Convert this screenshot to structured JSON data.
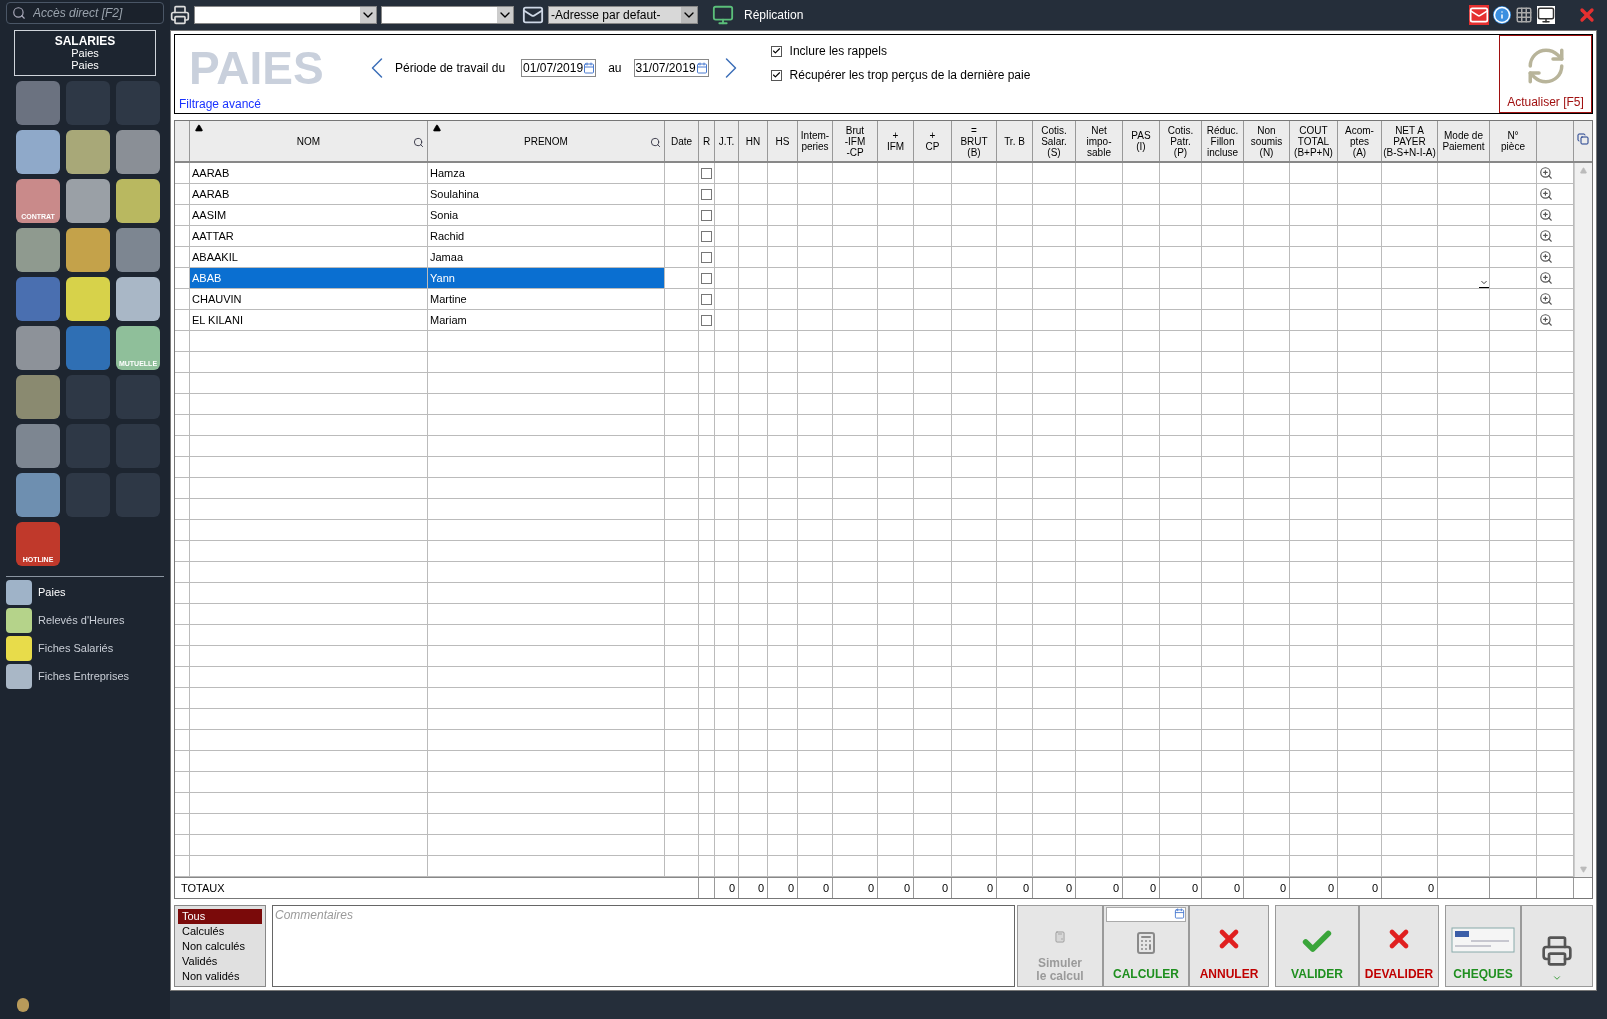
{
  "search": {
    "placeholder": "Accès direct [F2]"
  },
  "module": {
    "title": "SALARIES",
    "subtitle": "Paies",
    "section": "Paies"
  },
  "tiles": [
    {
      "kind": "app",
      "color": "#6b7280"
    },
    {
      "kind": "empty"
    },
    {
      "kind": "empty"
    },
    {
      "kind": "app",
      "color": "#8fa9c9"
    },
    {
      "kind": "app",
      "color": "#a8a878"
    },
    {
      "kind": "app",
      "color": "#8a8f96"
    },
    {
      "kind": "app",
      "color": "#c98a8a",
      "label": "CONTRAT"
    },
    {
      "kind": "app",
      "color": "#9aa0a6"
    },
    {
      "kind": "app",
      "color": "#b9b860"
    },
    {
      "kind": "app",
      "color": "#8f9a8f"
    },
    {
      "kind": "app",
      "color": "#c4a24a"
    },
    {
      "kind": "app",
      "color": "#7d8691"
    },
    {
      "kind": "app",
      "color": "#4a6fb0"
    },
    {
      "kind": "app",
      "color": "#d7d24a"
    },
    {
      "kind": "app",
      "color": "#a9b7c6"
    },
    {
      "kind": "app",
      "color": "#8d9299"
    },
    {
      "kind": "app",
      "color": "#2f6fb4"
    },
    {
      "kind": "app",
      "color": "#8fbf9a",
      "label": "MUTUELLE"
    },
    {
      "kind": "app",
      "color": "#8a8a70"
    },
    {
      "kind": "empty"
    },
    {
      "kind": "empty"
    },
    {
      "kind": "app",
      "color": "#7d8691"
    },
    {
      "kind": "empty"
    },
    {
      "kind": "empty"
    },
    {
      "kind": "app",
      "color": "#6e8fb0"
    },
    {
      "kind": "empty"
    },
    {
      "kind": "empty"
    },
    {
      "kind": "app",
      "color": "#c0392b",
      "label": "HOTLINE"
    }
  ],
  "nav": [
    {
      "label": "Paies",
      "selected": true,
      "color": "#9fb3c8"
    },
    {
      "label": "Relevés d'Heures",
      "selected": false,
      "color": "#b5d38a"
    },
    {
      "label": "Fiches Salariés",
      "selected": false,
      "color": "#e8dc4a"
    },
    {
      "label": "Fiches Entreprises",
      "selected": false,
      "color": "#a9b7c6"
    }
  ],
  "toolbar": {
    "address_select": "-Adresse par defaut-",
    "replication": "Réplication"
  },
  "header": {
    "watermark": "PAIES",
    "period_label": "Période de travail du",
    "date_from": "01/07/2019",
    "to_label": "au",
    "date_to": "31/07/2019",
    "options": [
      {
        "label": "Inclure les rappels",
        "checked": true
      },
      {
        "label": "Récupérer les trop perçus de la dernière paie",
        "checked": true
      }
    ],
    "advanced_filter": "Filtrage avancé",
    "refresh": "Actualiser [F5]"
  },
  "table": {
    "columns": [
      {
        "label": "NOM",
        "sortable": true
      },
      {
        "label": "PRENOM",
        "sortable": true
      },
      {
        "label": "Date",
        "sortable": false
      },
      {
        "label": "R",
        "sortable": false
      },
      {
        "label": "J.T.",
        "sortable": false
      },
      {
        "label": "HN",
        "sortable": false
      },
      {
        "label": "HS",
        "sortable": false
      },
      {
        "label": "Intem-\nperies",
        "sortable": false
      },
      {
        "label": "Brut\n-IFM\n-CP",
        "sortable": false
      },
      {
        "label": "+\nIFM",
        "sortable": false
      },
      {
        "label": "+\nCP",
        "sortable": false
      },
      {
        "label": "=\nBRUT\n(B)",
        "sortable": false
      },
      {
        "label": "Tr. B",
        "sortable": false
      },
      {
        "label": "Cotis.\nSalar.\n(S)",
        "sortable": false
      },
      {
        "label": "Net\nimpo-\nsable",
        "sortable": false
      },
      {
        "label": "PAS\n(I)",
        "sortable": false
      },
      {
        "label": "Cotis.\nPatr.\n(P)",
        "sortable": false
      },
      {
        "label": "Réduc.\nFillon\nincluse",
        "sortable": false
      },
      {
        "label": "Non\nsoumis\n(N)",
        "sortable": false
      },
      {
        "label": "COUT\nTOTAL\n(B+P+N)",
        "sortable": false
      },
      {
        "label": "Acom-\nptes\n(A)",
        "sortable": false
      },
      {
        "label": "NET A\nPAYER\n(B-S+N-I-A)",
        "sortable": false
      },
      {
        "label": "Mode de\nPaiement",
        "sortable": false
      },
      {
        "label": "N°\npièce",
        "sortable": false
      }
    ],
    "rows": [
      {
        "nom": "AARAB",
        "prenom": "Hamza",
        "r": false,
        "selected": false
      },
      {
        "nom": "AARAB",
        "prenom": "Soulahina",
        "r": false,
        "selected": false
      },
      {
        "nom": "AASIM",
        "prenom": "Sonia",
        "r": false,
        "selected": false
      },
      {
        "nom": "AATTAR",
        "prenom": "Rachid",
        "r": false,
        "selected": false
      },
      {
        "nom": "ABAAKIL",
        "prenom": "Jamaa",
        "r": false,
        "selected": false
      },
      {
        "nom": "ABAB",
        "prenom": "Yann",
        "r": false,
        "selected": true
      },
      {
        "nom": "CHAUVIN",
        "prenom": "Martine",
        "r": false,
        "selected": false
      },
      {
        "nom": "EL KILANI",
        "prenom": "Mariam",
        "r": false,
        "selected": false
      }
    ],
    "totals": {
      "label": "TOTAUX",
      "values": [
        "0",
        "0",
        "0",
        "0",
        "0",
        "0",
        "0",
        "0",
        "0",
        "0",
        "0",
        "0",
        "0",
        "0",
        "0",
        "0",
        "0",
        "0"
      ]
    }
  },
  "filters": [
    {
      "label": "Tous",
      "selected": true
    },
    {
      "label": "Calculés",
      "selected": false
    },
    {
      "label": "Non calculés",
      "selected": false
    },
    {
      "label": "Validés",
      "selected": false
    },
    {
      "label": "Non validés",
      "selected": false
    }
  ],
  "comment": {
    "placeholder": "Commentaires"
  },
  "actions": [
    {
      "label": "Simuler le calcul",
      "kind": "simulate",
      "disabled": true
    },
    {
      "label": "CALCULER",
      "kind": "calculate",
      "disabled": false
    },
    {
      "label": "ANNULER",
      "kind": "cancel",
      "disabled": false
    },
    {
      "label": "VALIDER",
      "kind": "validate",
      "disabled": false
    },
    {
      "label": "DEVALIDER",
      "kind": "cancel",
      "disabled": false
    },
    {
      "label": "CHEQUES",
      "kind": "cheques",
      "disabled": false
    },
    {
      "kind": "print",
      "disabled": false
    }
  ]
}
